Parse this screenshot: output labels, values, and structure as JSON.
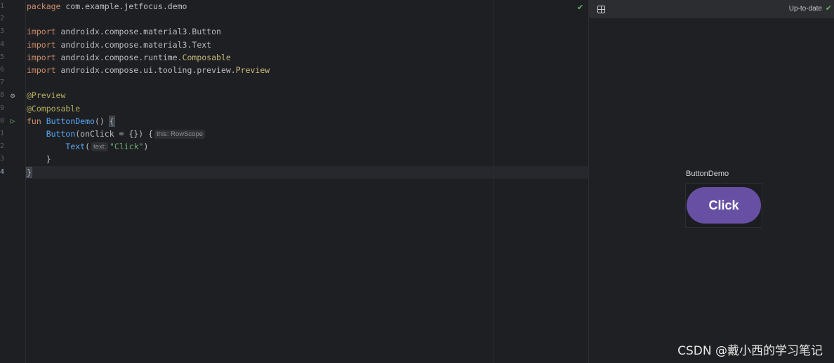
{
  "editor": {
    "lines": [
      {
        "num": "1",
        "tokens": [
          {
            "t": "package",
            "c": "kw"
          },
          {
            "t": " com.example.jetfocus.demo",
            "c": ""
          }
        ]
      },
      {
        "num": "2",
        "tokens": []
      },
      {
        "num": "3",
        "tokens": [
          {
            "t": "import",
            "c": "kw"
          },
          {
            "t": " androidx.compose.material3.Button",
            "c": ""
          }
        ]
      },
      {
        "num": "4",
        "tokens": [
          {
            "t": "import",
            "c": "kw"
          },
          {
            "t": " androidx.compose.material3.Text",
            "c": ""
          }
        ]
      },
      {
        "num": "5",
        "tokens": [
          {
            "t": "import",
            "c": "kw"
          },
          {
            "t": " androidx.compose.runtime.",
            "c": ""
          },
          {
            "t": "Composable",
            "c": "cls"
          }
        ]
      },
      {
        "num": "6",
        "tokens": [
          {
            "t": "import",
            "c": "kw"
          },
          {
            "t": " androidx.compose.ui.tooling.preview.",
            "c": ""
          },
          {
            "t": "Preview",
            "c": "cls"
          }
        ]
      },
      {
        "num": "7",
        "tokens": []
      },
      {
        "num": "8",
        "tokens": [
          {
            "t": "@Preview",
            "c": "ann"
          }
        ]
      },
      {
        "num": "9",
        "tokens": [
          {
            "t": "@Composable",
            "c": "ann"
          }
        ]
      },
      {
        "num": "0",
        "tokens": [
          {
            "t": "fun",
            "c": "kw"
          },
          {
            "t": " ",
            "c": ""
          },
          {
            "t": "ButtonDemo",
            "c": "fn"
          },
          {
            "t": "() ",
            "c": ""
          },
          {
            "t": "{",
            "c": "brace"
          }
        ]
      },
      {
        "num": "1",
        "tokens": [
          {
            "t": "    ",
            "c": ""
          },
          {
            "t": "Button",
            "c": "comp"
          },
          {
            "t": "(onClick = {}) {",
            "c": ""
          },
          {
            "t": "this: RowScope",
            "c": "hint"
          }
        ]
      },
      {
        "num": "2",
        "tokens": [
          {
            "t": "        ",
            "c": ""
          },
          {
            "t": "Text",
            "c": "comp"
          },
          {
            "t": "(",
            "c": ""
          },
          {
            "t": "text:",
            "c": "hint"
          },
          {
            "t": "\"Click\"",
            "c": "str"
          },
          {
            "t": ")",
            "c": ""
          }
        ]
      },
      {
        "num": "3",
        "tokens": [
          {
            "t": "    }",
            "c": ""
          }
        ]
      },
      {
        "num": "4",
        "tokens": [
          {
            "t": "}",
            "c": "brace"
          }
        ],
        "current": true
      }
    ]
  },
  "preview": {
    "status": "Up-to-date",
    "title": "ButtonDemo",
    "button_label": "Click"
  },
  "watermark": "CSDN @戴小西的学习笔记",
  "colors": {
    "button": "#6750a4",
    "keyword": "#cf8e6d",
    "annotation": "#b3ae60",
    "function": "#56a8f5",
    "string": "#6aab73",
    "ok_green": "#5fb865"
  }
}
